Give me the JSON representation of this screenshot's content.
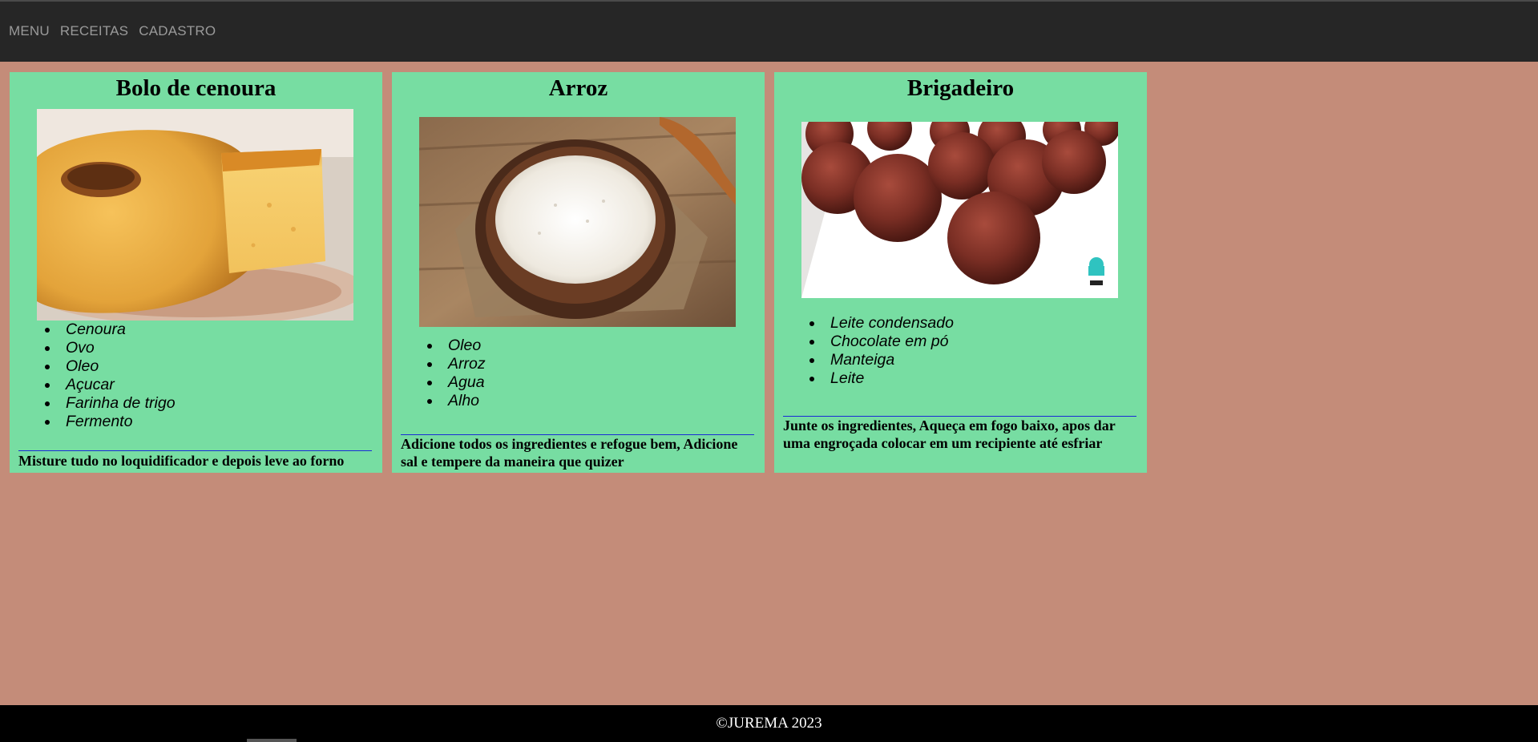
{
  "nav": {
    "items": [
      "MENU",
      "RECEITAS",
      "CADASTRO"
    ]
  },
  "recipes": [
    {
      "title": "Bolo de cenoura",
      "image": "carrot-cake-photo",
      "ingredients": [
        "Cenoura",
        "Ovo",
        "Oleo",
        "Açucar",
        "Farinha de trigo",
        "Fermento"
      ],
      "instructions": "Misture tudo no loquidificador e depois leve ao forno"
    },
    {
      "title": "Arroz",
      "image": "rice-bowl-photo",
      "ingredients": [
        "Oleo",
        "Arroz",
        "Agua",
        "Alho"
      ],
      "instructions": "Adicione todos os ingredientes e refogue bem, Adicione sal e tempere da maneira que quizer"
    },
    {
      "title": "Brigadeiro",
      "image": "brigadeiro-photo",
      "ingredients": [
        "Leite condensado",
        "Chocolate em pó",
        "Manteiga",
        "Leite"
      ],
      "instructions": "Junte os ingredientes, Aqueça em fogo baixo, apos dar uma engroçada colocar em um recipiente até esfriar"
    }
  ],
  "footer": {
    "text": "©JUREMA 2023"
  },
  "colors": {
    "page_background": "#c48c79",
    "topbar": "#262626",
    "card": "#77dda2",
    "divider": "#1a2bd6",
    "footer": "#000000"
  }
}
